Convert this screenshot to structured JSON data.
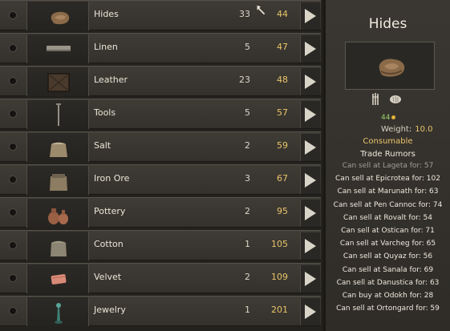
{
  "items": [
    {
      "name": "Hides",
      "qty": "33",
      "price": "44",
      "icon": "hides-icon"
    },
    {
      "name": "Linen",
      "qty": "5",
      "price": "47",
      "icon": "linen-icon"
    },
    {
      "name": "Leather",
      "qty": "23",
      "price": "48",
      "icon": "leather-icon"
    },
    {
      "name": "Tools",
      "qty": "5",
      "price": "57",
      "icon": "tools-icon"
    },
    {
      "name": "Salt",
      "qty": "2",
      "price": "59",
      "icon": "salt-icon"
    },
    {
      "name": "Iron Ore",
      "qty": "3",
      "price": "67",
      "icon": "iron-ore-icon"
    },
    {
      "name": "Pottery",
      "qty": "2",
      "price": "95",
      "icon": "pottery-icon"
    },
    {
      "name": "Cotton",
      "qty": "1",
      "price": "105",
      "icon": "cotton-icon"
    },
    {
      "name": "Velvet",
      "qty": "2",
      "price": "109",
      "icon": "velvet-icon"
    },
    {
      "name": "Jewelry",
      "qty": "1",
      "price": "201",
      "icon": "jewelry-icon"
    }
  ],
  "panel": {
    "title": "Hides",
    "value": "44",
    "weight_label": "Weight:",
    "weight_value": "10.0",
    "category": "Consumable",
    "rumors_title": "Trade Rumors",
    "rumors": [
      {
        "text": "Can sell at Lageta for: 57",
        "dim": true
      },
      {
        "text": "Can sell at Epicrotea for: 102",
        "dim": false
      },
      {
        "text": "Can sell at Marunath for: 63",
        "dim": false
      },
      {
        "text": "Can sell at Pen Cannoc for: 74",
        "dim": false
      },
      {
        "text": "Can sell at Rovalt for: 54",
        "dim": false
      },
      {
        "text": "Can sell at Ostican for: 71",
        "dim": false
      },
      {
        "text": "Can sell at Varcheg for: 65",
        "dim": false
      },
      {
        "text": "Can sell at Quyaz for: 56",
        "dim": false
      },
      {
        "text": "Can sell at Sanala for: 69",
        "dim": false
      },
      {
        "text": "Can sell at Danustica for: 63",
        "dim": false
      },
      {
        "text": "Can buy at Odokh for: 28",
        "dim": false
      },
      {
        "text": "Can sell at Ortongard for: 59",
        "dim": false
      }
    ]
  },
  "colors": {
    "price": "#e9c46a",
    "value": "#9ccf6a",
    "category": "#e9c46a",
    "rumor_dim": "#a39d92"
  }
}
